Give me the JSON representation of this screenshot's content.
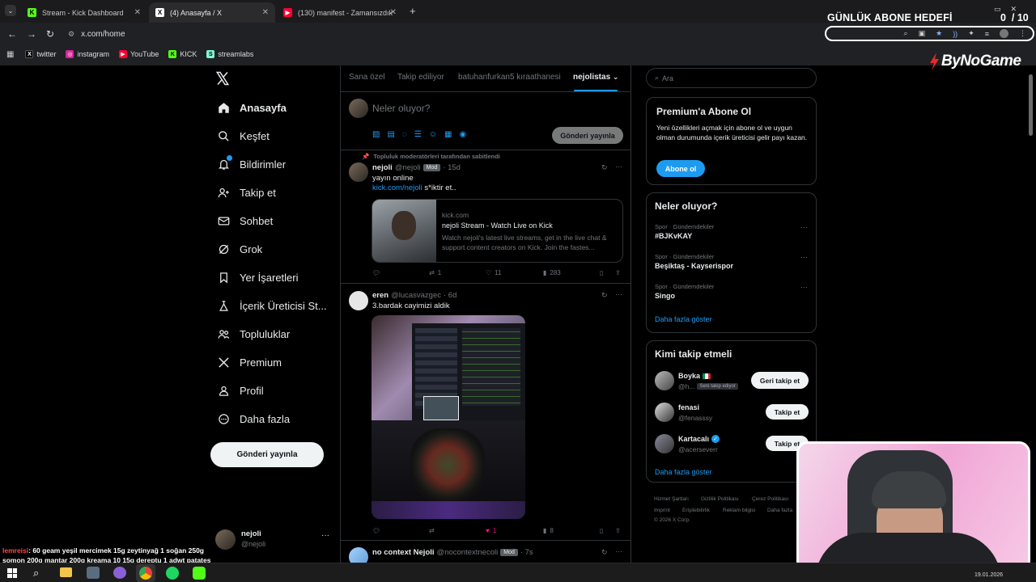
{
  "browser": {
    "tabs": [
      {
        "label": "Stream - Kick Dashboard",
        "icon": "kick-icon"
      },
      {
        "label": "(4) Anasayfa / X",
        "icon": "x-icon"
      },
      {
        "label": "(130) manifest - Zamansızdık |",
        "icon": "youtube-icon"
      }
    ],
    "url": "x.com/home",
    "bookmarks": [
      "twitter",
      "instagram",
      "YouTube",
      "KICK",
      "streamlabs"
    ]
  },
  "overlay": {
    "goal_label": "GÜNLÜK ABONE HEDEFİ",
    "goal_value": "0  / 10",
    "brand": "ByNoGame",
    "chat_user": "lemreisi",
    "chat_text": ": 60 geam yeşil mercimek 15g zeytinyağ 1 soğan 250g somon 200g mantar 200g kreama 10 15g dereptu 1 adwt patates",
    "clock_date": "19.01.2026"
  },
  "nav": {
    "items": [
      "Anasayfa",
      "Keşfet",
      "Bildirimler",
      "Takip et",
      "Sohbet",
      "Grok",
      "Yer İşaretleri",
      "İçerik Üreticisi St...",
      "Topluluklar",
      "Premium",
      "Profil",
      "Daha fazla"
    ],
    "post_button": "Gönderi yayınla",
    "user_name": "nejoli",
    "user_handle": "@nejoli",
    "more": "···"
  },
  "feed": {
    "tabs": [
      "Sana özel",
      "Takip ediliyor",
      "batuhanfurkan5 kıraathanesi",
      "nejolistas"
    ],
    "compose_placeholder": "Neler oluyor?",
    "compose_button": "Gönderi yayınla",
    "pinned_label": "Topluluk moderatörleri tarafından sabitlendi",
    "tweet1": {
      "name": "nejoli",
      "handle": "@nejoli",
      "badge": "Mod",
      "time": "· 15d",
      "line1": "yayın online",
      "link": "kick.com/nejoli",
      "line2": " s*iktir et..",
      "card_domain": "kick.com",
      "card_title": "nejoli Stream - Watch Live on Kick",
      "card_desc": "Watch nejoli's latest live streams, get in the live chat & support content creators on Kick. Join the fastes...",
      "retweets": "1",
      "likes": "11",
      "views": "283"
    },
    "tweet2": {
      "name": "eren",
      "handle": "@lucasvazgec",
      "time": "· 6d",
      "text": "3.bardak cayimizi aldik",
      "likes": "1",
      "views": "8"
    },
    "tweet3": {
      "name": "no context Nejoli",
      "handle": "@nocontextnecoli",
      "badge": "Mod",
      "time": "· 7s"
    }
  },
  "right": {
    "search_placeholder": "Ara",
    "premium": {
      "title": "Premium'a Abone Ol",
      "text": "Yeni özellikleri açmak için abone ol ve uygun olman durumunda içerik üreticisi gelir payı kazan.",
      "button": "Abone ol"
    },
    "trends": {
      "title": "Neler oluyor?",
      "items": [
        {
          "cat": "Spor · Gündemdekiler",
          "name": "#BJKvKAY"
        },
        {
          "cat": "Spor · Gündemdekiler",
          "name": "Beşiktaş - Kayserispor"
        },
        {
          "cat": "Spor · Gündemdekiler",
          "name": "Singo"
        }
      ],
      "more": "Daha fazla göster"
    },
    "who": {
      "title": "Kimi takip etmeli",
      "items": [
        {
          "name": "Boyka",
          "handle": "@h...",
          "note": "Seni takip ediyor",
          "button": "Geri takip et"
        },
        {
          "name": "fenasi",
          "handle": "@fenasssy",
          "button": "Takip et"
        },
        {
          "name": "Kartacalı",
          "handle": "@acerseverr",
          "button": "Takip et"
        }
      ],
      "more": "Daha fazla göster"
    },
    "footer": [
      "Hizmet Şartları",
      "Gizlilik Politikası",
      "Çerez Politikası",
      "Imprint",
      "Erişilebilirlik",
      "Reklam bilgisi",
      "Daha fazla",
      "© 2026 X Corp."
    ]
  },
  "colors": {
    "accent": "#1d9bf0",
    "like": "#f91880",
    "kick": "#53fc18"
  }
}
